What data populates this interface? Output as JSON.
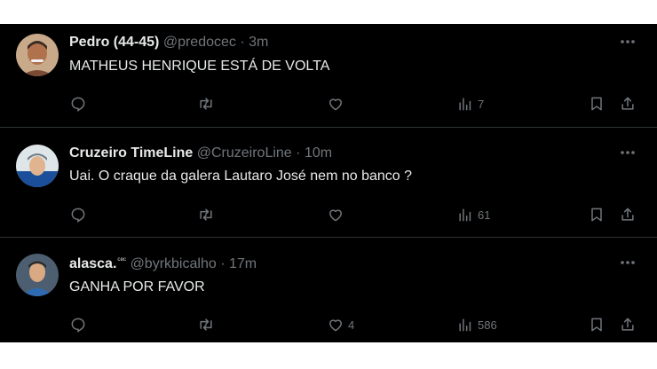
{
  "tweets": [
    {
      "display_name": "Pedro (44-45)",
      "handle": "@predocec",
      "sep": "·",
      "time": "3m",
      "badge": "",
      "text": "MATHEUS HENRIQUE ESTÁ DE VOLTA",
      "likes": "",
      "views": "7",
      "avatar_colors": {
        "bg": "#c8a98a",
        "skin": "#b0724d",
        "hair": "#3a2a22"
      }
    },
    {
      "display_name": "Cruzeiro TimeLine",
      "handle": "@CruzeiroLine",
      "sep": "·",
      "time": "10m",
      "badge": "",
      "text": "Uai. O craque da galera Lautaro José nem no banco ?",
      "likes": "",
      "views": "61",
      "avatar_colors": {
        "bg": "#dfe6ea",
        "skin": "#e0b48f",
        "hair": "#6d7b84"
      }
    },
    {
      "display_name": "alasca.",
      "handle": "@byrkbicalho",
      "sep": "·",
      "time": "17m",
      "badge": "ᶜᵉᶜ",
      "text": "GANHA POR FAVOR",
      "likes": "4",
      "views": "586",
      "avatar_colors": {
        "bg": "#4d5e70",
        "skin": "#d9a983",
        "hair": "#2a2a2a"
      }
    }
  ],
  "icons": {
    "reply": "reply-icon",
    "retweet": "retweet-icon",
    "like": "heart-icon",
    "views": "views-icon",
    "bookmark": "bookmark-icon",
    "share": "share-icon",
    "more": "more-icon"
  },
  "colors": {
    "background": "#000000",
    "text": "#e7e9ea",
    "muted": "#71767b",
    "divider": "#2f3336"
  }
}
